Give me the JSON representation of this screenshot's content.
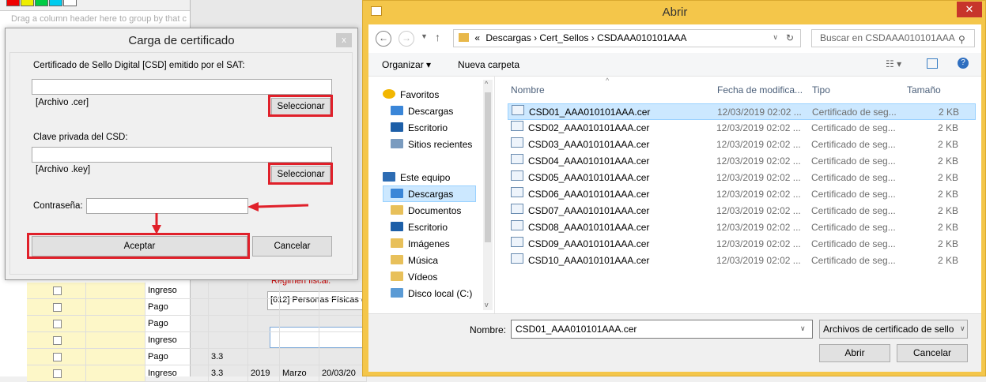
{
  "background": {
    "group_hint": "Drag a column header here to group by that c",
    "grid_rows": [
      {
        "tipo": "Ingreso",
        "ver": "",
        "year": "",
        "month": "",
        "date": ""
      },
      {
        "tipo": "Pago",
        "ver": "",
        "year": "",
        "month": "",
        "date": ""
      },
      {
        "tipo": "Pago",
        "ver": "",
        "year": "",
        "month": "",
        "date": ""
      },
      {
        "tipo": "Ingreso",
        "ver": "",
        "year": "",
        "month": "",
        "date": ""
      },
      {
        "tipo": "Pago",
        "ver": "3.3",
        "year": "",
        "month": "",
        "date": ""
      },
      {
        "tipo": "Ingreso",
        "ver": "3.3",
        "year": "2019",
        "month": "Marzo",
        "date": "20/03/20"
      }
    ],
    "regimen_label": "Regimen fiscal:",
    "regimen_value": "[612] Personas Físicas c"
  },
  "carga": {
    "title": "Carga de certificado",
    "close": "x",
    "cert_label": "Certificado de Sello Digital [CSD] emitido por el SAT:",
    "cert_value": "",
    "cert_hint": "[Archivo .cer]",
    "select_cer": "Seleccionar",
    "key_label": "Clave privada del CSD:",
    "key_value": "",
    "key_hint": "[Archivo .key]",
    "select_key": "Seleccionar",
    "password_label": "Contraseña:",
    "password_value": "",
    "accept": "Aceptar",
    "cancel": "Cancelar"
  },
  "abrir": {
    "title": "Abrir",
    "close": "✕",
    "path": [
      "Descargas",
      "Cert_Sellos",
      "CSDAAA010101AAA"
    ],
    "path_prefix": "«",
    "search_placeholder": "Buscar en CSDAAA010101AAA",
    "organize": "Organizar ▾",
    "new_folder": "Nueva carpeta",
    "sidebar": {
      "favorites": "Favoritos",
      "fav_items": [
        "Descargas",
        "Escritorio",
        "Sitios recientes"
      ],
      "pc": "Este equipo",
      "pc_items": [
        "Descargas",
        "Documentos",
        "Escritorio",
        "Imágenes",
        "Música",
        "Vídeos",
        "Disco local (C:)"
      ]
    },
    "columns": {
      "name": "Nombre",
      "date": "Fecha de modifica...",
      "type": "Tipo",
      "size": "Tamaño"
    },
    "files": [
      {
        "name": "CSD01_AAA010101AAA.cer",
        "date": "12/03/2019 02:02 ...",
        "type": "Certificado de seg...",
        "size": "2 KB"
      },
      {
        "name": "CSD02_AAA010101AAA.cer",
        "date": "12/03/2019 02:02 ...",
        "type": "Certificado de seg...",
        "size": "2 KB"
      },
      {
        "name": "CSD03_AAA010101AAA.cer",
        "date": "12/03/2019 02:02 ...",
        "type": "Certificado de seg...",
        "size": "2 KB"
      },
      {
        "name": "CSD04_AAA010101AAA.cer",
        "date": "12/03/2019 02:02 ...",
        "type": "Certificado de seg...",
        "size": "2 KB"
      },
      {
        "name": "CSD05_AAA010101AAA.cer",
        "date": "12/03/2019 02:02 ...",
        "type": "Certificado de seg...",
        "size": "2 KB"
      },
      {
        "name": "CSD06_AAA010101AAA.cer",
        "date": "12/03/2019 02:02 ...",
        "type": "Certificado de seg...",
        "size": "2 KB"
      },
      {
        "name": "CSD07_AAA010101AAA.cer",
        "date": "12/03/2019 02:02 ...",
        "type": "Certificado de seg...",
        "size": "2 KB"
      },
      {
        "name": "CSD08_AAA010101AAA.cer",
        "date": "12/03/2019 02:02 ...",
        "type": "Certificado de seg...",
        "size": "2 KB"
      },
      {
        "name": "CSD09_AAA010101AAA.cer",
        "date": "12/03/2019 02:02 ...",
        "type": "Certificado de seg...",
        "size": "2 KB"
      },
      {
        "name": "CSD10_AAA010101AAA.cer",
        "date": "12/03/2019 02:02 ...",
        "type": "Certificado de seg...",
        "size": "2 KB"
      }
    ],
    "filename_label": "Nombre:",
    "filename_value": "CSD01_AAA010101AAA.cer",
    "filter": "Archivos de certificado de sello",
    "open": "Abrir",
    "cancel": "Cancelar"
  },
  "colors": {
    "annotation_red": "#e0202a",
    "title_bar_gold": "#f4c64a",
    "selection_blue": "#cce8ff"
  }
}
